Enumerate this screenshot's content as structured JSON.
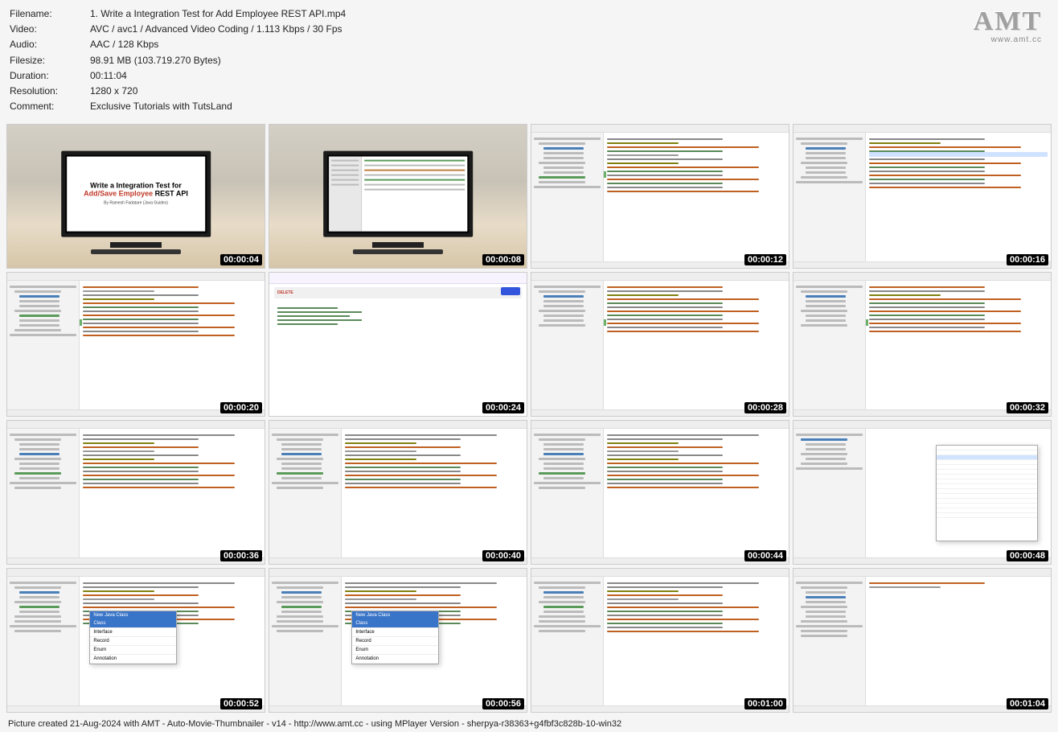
{
  "meta": {
    "labels": {
      "filename": "Filename:",
      "video": "Video:",
      "audio": "Audio:",
      "filesize": "Filesize:",
      "duration": "Duration:",
      "resolution": "Resolution:",
      "comment": "Comment:"
    },
    "values": {
      "filename": "1. Write a Integration Test for Add Employee REST API.mp4",
      "video": "AVC / avc1 / Advanced Video Coding / 1.113 Kbps / 30 Fps",
      "audio": "AAC / 128 Kbps",
      "filesize": "98.91 MB (103.719.270 Bytes)",
      "duration": "00:11:04",
      "resolution": "1280 x 720",
      "comment": "Exclusive Tutorials with TutsLand"
    }
  },
  "logo": {
    "text": "AMT",
    "url": "www.amt.cc"
  },
  "timestamps": [
    "00:00:04",
    "00:00:08",
    "00:00:12",
    "00:00:16",
    "00:00:20",
    "00:00:24",
    "00:00:28",
    "00:00:32",
    "00:00:36",
    "00:00:40",
    "00:00:44",
    "00:00:48",
    "00:00:52",
    "00:00:56",
    "00:01:00",
    "00:01:04"
  ],
  "slide": {
    "line1": "Write a Integration Test for",
    "line2_red": "Add/Save Employee",
    "line2_black": " REST API",
    "author": "By Ramesh Fadatare (Java Guides)"
  },
  "postman": {
    "method": "DELETE"
  },
  "popup": {
    "title": "New Java Class",
    "items": [
      "Class",
      "Interface",
      "Record",
      "Enum",
      "Annotation"
    ]
  },
  "footer": "Picture created 21-Aug-2024 with AMT - Auto-Movie-Thumbnailer - v14 - http://www.amt.cc - using MPlayer Version - sherpya-r38363+g4fbf3c828b-10-win32"
}
